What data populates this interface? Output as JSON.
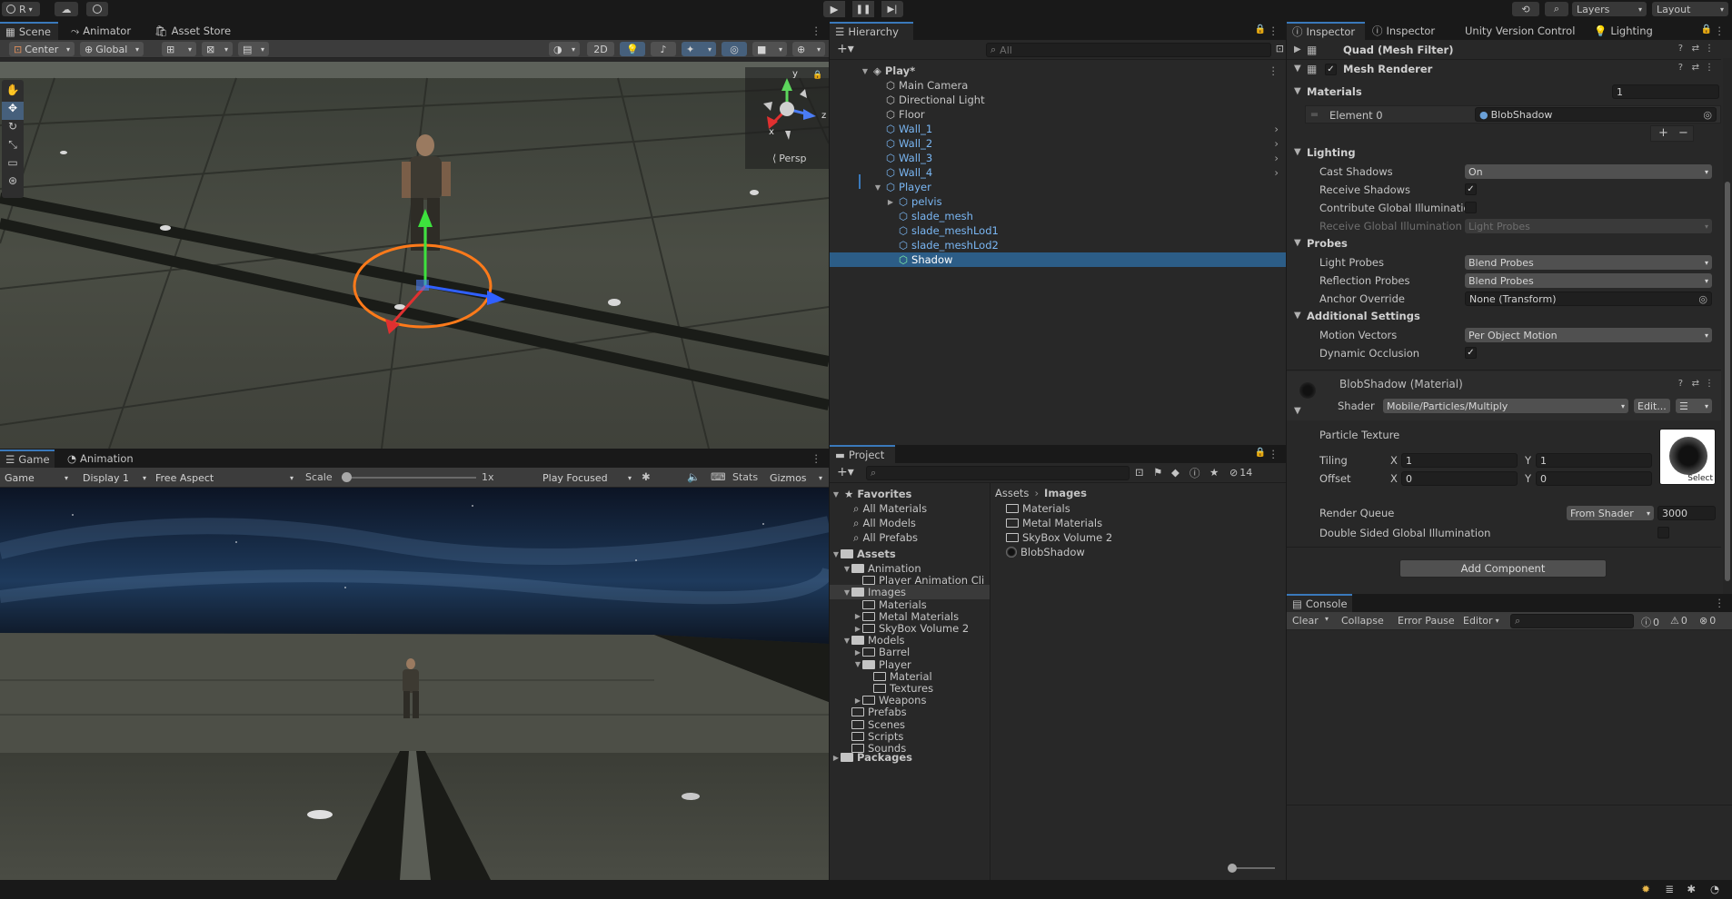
{
  "toolbar": {
    "account_label": "R",
    "layers_label": "Layers",
    "layout_label": "Layout"
  },
  "scene_panel": {
    "tabs": [
      "Scene",
      "Animator",
      "Asset Store"
    ],
    "pivot_label": "Center",
    "space_label": "Global",
    "mode_2d": "2D",
    "persp_label": "Persp",
    "gizmo_axes": {
      "y": "y",
      "x": "x",
      "z": "z"
    }
  },
  "game_panel": {
    "tabs": [
      "Game",
      "Animation"
    ],
    "game_dropdown": "Game",
    "display_dropdown": "Display 1",
    "aspect_dropdown": "Free Aspect",
    "scale_label": "Scale",
    "scale_value": "1x",
    "scale_fraction": 0.0,
    "play_focused": "Play Focused",
    "stats_label": "Stats",
    "gizmos_label": "Gizmos"
  },
  "hierarchy": {
    "tab": "Hierarchy",
    "search_placeholder": "All",
    "scene_name": "Play*",
    "items": [
      {
        "label": "Main Camera",
        "depth": 1,
        "prefab": false,
        "arrow": false
      },
      {
        "label": "Directional Light",
        "depth": 1,
        "prefab": false,
        "arrow": false
      },
      {
        "label": "Floor",
        "depth": 1,
        "prefab": false,
        "arrow": false
      },
      {
        "label": "Wall_1",
        "depth": 1,
        "prefab": true,
        "arrow": true
      },
      {
        "label": "Wall_2",
        "depth": 1,
        "prefab": true,
        "arrow": true
      },
      {
        "label": "Wall_3",
        "depth": 1,
        "prefab": true,
        "arrow": true
      },
      {
        "label": "Wall_4",
        "depth": 1,
        "prefab": true,
        "arrow": true
      },
      {
        "label": "Player",
        "depth": 1,
        "prefab": true,
        "arrow": false
      },
      {
        "label": "pelvis",
        "depth": 2,
        "prefab": true,
        "arrow": false
      },
      {
        "label": "slade_mesh",
        "depth": 2,
        "prefab": true,
        "arrow": false
      },
      {
        "label": "slade_meshLod1",
        "depth": 2,
        "prefab": true,
        "arrow": false
      },
      {
        "label": "slade_meshLod2",
        "depth": 2,
        "prefab": true,
        "arrow": false
      },
      {
        "label": "Shadow",
        "depth": 2,
        "prefab": false,
        "arrow": false,
        "selected": true
      }
    ]
  },
  "project": {
    "tab": "Project",
    "hidden_count": "14",
    "favorites_label": "Favorites",
    "favorites": [
      "All Materials",
      "All Models",
      "All Prefabs"
    ],
    "assets_label": "Assets",
    "tree": [
      {
        "label": "Animation",
        "depth": 1,
        "expanded": true
      },
      {
        "label": "Player Animation Cli",
        "depth": 2
      },
      {
        "label": "Images",
        "depth": 1,
        "expanded": true,
        "highlight": true
      },
      {
        "label": "Materials",
        "depth": 2
      },
      {
        "label": "Metal Materials",
        "depth": 2,
        "collapsed": true
      },
      {
        "label": "SkyBox Volume 2",
        "depth": 2,
        "collapsed": true
      },
      {
        "label": "Models",
        "depth": 1,
        "expanded": true
      },
      {
        "label": "Barrel",
        "depth": 2,
        "collapsed": true
      },
      {
        "label": "Player",
        "depth": 2,
        "expanded": true
      },
      {
        "label": "Material",
        "depth": 3
      },
      {
        "label": "Textures",
        "depth": 3
      },
      {
        "label": "Weapons",
        "depth": 2,
        "collapsed": true
      },
      {
        "label": "Prefabs",
        "depth": 1
      },
      {
        "label": "Scenes",
        "depth": 1
      },
      {
        "label": "Scripts",
        "depth": 1
      },
      {
        "label": "Sounds",
        "depth": 1
      }
    ],
    "packages_label": "Packages",
    "breadcrumb": [
      "Assets",
      "Images"
    ],
    "files": [
      "Materials",
      "Metal Materials",
      "SkyBox Volume 2",
      "BlobShadow"
    ]
  },
  "inspector": {
    "tabs": [
      "Inspector",
      "Inspector",
      "Unity Version Control",
      "Lighting"
    ],
    "component_mesh_filter": "Quad (Mesh Filter)",
    "component_mesh_renderer": "Mesh Renderer",
    "materials_label": "Materials",
    "materials_count": "1",
    "element0_label": "Element 0",
    "element0_value": "BlobShadow",
    "lighting_header": "Lighting",
    "cast_shadows_label": "Cast Shadows",
    "cast_shadows_value": "On",
    "receive_shadows_label": "Receive Shadows",
    "contribute_gi_label": "Contribute Global Illuminatio",
    "receive_gi_label": "Receive Global Illumination",
    "receive_gi_value": "Light Probes",
    "probes_header": "Probes",
    "light_probes_label": "Light Probes",
    "light_probes_value": "Blend Probes",
    "reflection_probes_label": "Reflection Probes",
    "reflection_probes_value": "Blend Probes",
    "anchor_override_label": "Anchor Override",
    "anchor_override_value": "None (Transform)",
    "additional_header": "Additional Settings",
    "motion_vectors_label": "Motion Vectors",
    "motion_vectors_value": "Per Object Motion",
    "dynamic_occlusion_label": "Dynamic Occlusion",
    "material_name": "BlobShadow (Material)",
    "shader_label": "Shader",
    "shader_value": "Mobile/Particles/Multiply",
    "edit_label": "Edit...",
    "particle_texture_label": "Particle Texture",
    "tiling_label": "Tiling",
    "tiling_x": "1",
    "tiling_y": "1",
    "offset_label": "Offset",
    "offset_x": "0",
    "offset_y": "0",
    "x_label": "X",
    "y_label": "Y",
    "select_label": "Select",
    "render_queue_label": "Render Queue",
    "render_queue_source": "From Shader",
    "render_queue_value": "3000",
    "double_sided_label": "Double Sided Global Illumination",
    "add_component_label": "Add Component"
  },
  "console": {
    "tab": "Console",
    "clear_label": "Clear",
    "collapse_label": "Collapse",
    "error_pause_label": "Error Pause",
    "editor_label": "Editor",
    "log_count": "0",
    "warn_count": "0",
    "error_count": "0"
  },
  "colors": {
    "selection": "#2c5d87",
    "prefab_blue": "#7ab7f4",
    "panel_bg": "#282828",
    "toolbar_bg": "#191919",
    "tab_active_accent": "#3a79bb"
  }
}
